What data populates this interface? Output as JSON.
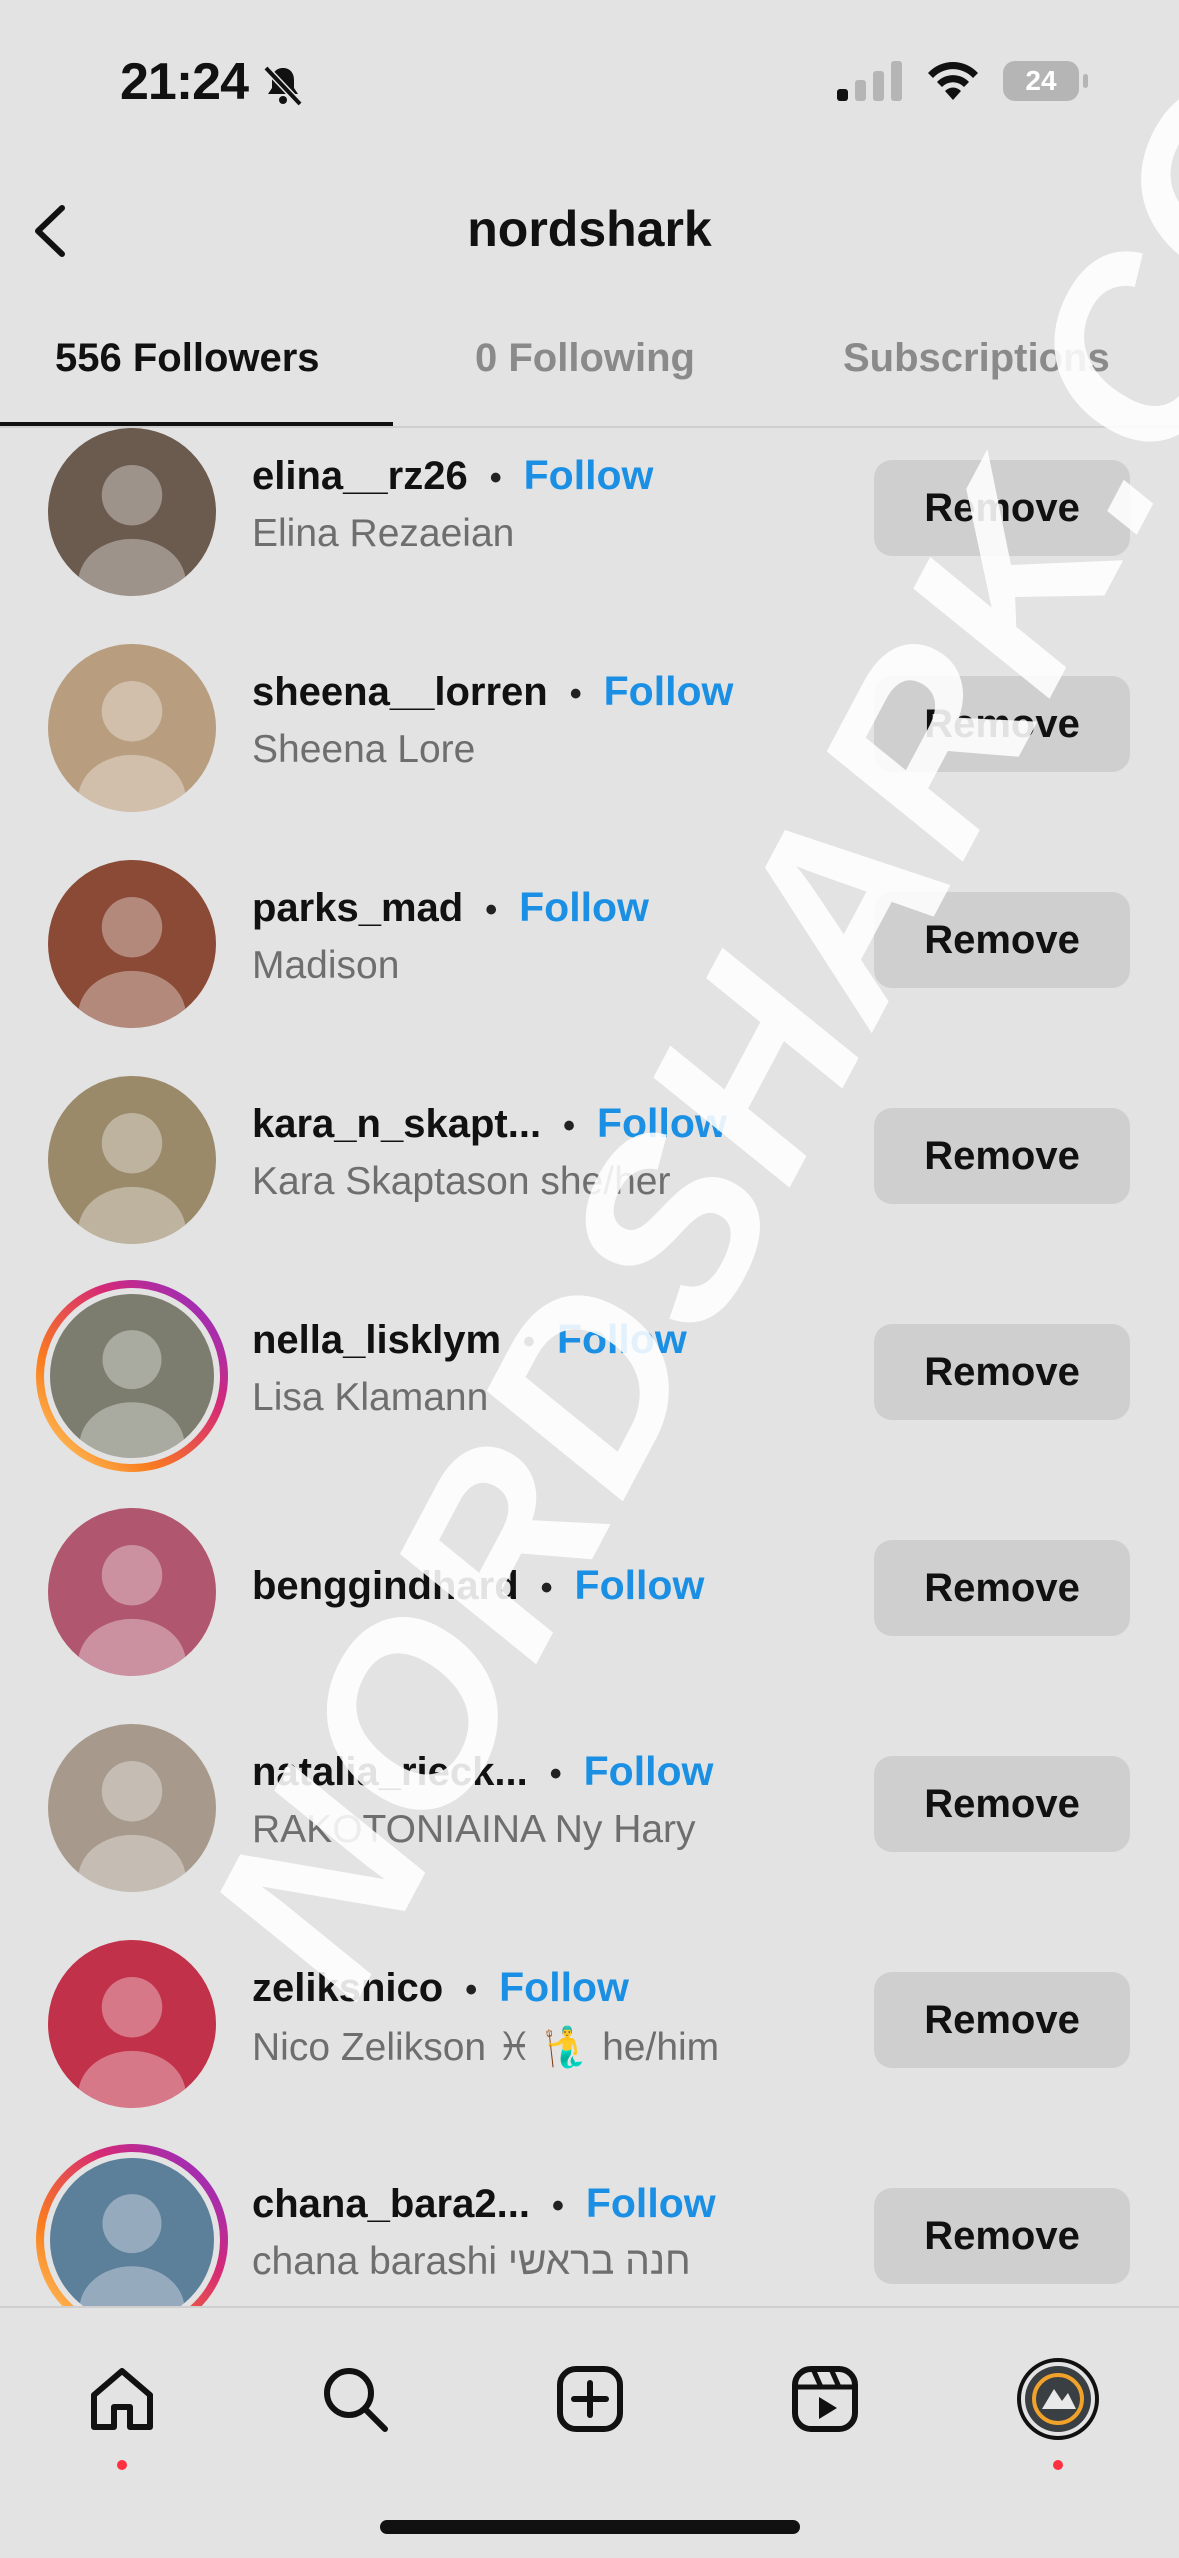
{
  "status_bar": {
    "time": "21:24",
    "battery": "24"
  },
  "header": {
    "title": "nordshark"
  },
  "tabs": [
    {
      "label": "556 Followers",
      "active": true
    },
    {
      "label": "0 Following",
      "active": false
    },
    {
      "label": "Subscriptions",
      "active": false
    }
  ],
  "followers": [
    {
      "username": "elina__rz26",
      "fullname": "Elina Rezaeian",
      "follow_label": "Follow",
      "remove_label": "Remove",
      "has_story": false,
      "avatar_color": "#6b5a4e"
    },
    {
      "username": "sheena__lorren",
      "fullname": "Sheena Lore",
      "follow_label": "Follow",
      "remove_label": "Remove",
      "has_story": false,
      "avatar_color": "#b89d7f"
    },
    {
      "username": "parks_mad",
      "fullname": "Madison",
      "follow_label": "Follow",
      "remove_label": "Remove",
      "has_story": false,
      "avatar_color": "#8a4a36"
    },
    {
      "username": "kara_n_skapt...",
      "fullname": "Kara Skaptason she/her",
      "follow_label": "Follow",
      "remove_label": "Remove",
      "has_story": false,
      "avatar_color": "#9a8a6a"
    },
    {
      "username": "nella_lisklym",
      "fullname": "Lisa Klamann",
      "follow_label": "Follow",
      "remove_label": "Remove",
      "has_story": true,
      "avatar_color": "#7c7d6e"
    },
    {
      "username": "benggindhard",
      "fullname": "",
      "follow_label": "Follow",
      "remove_label": "Remove",
      "has_story": false,
      "avatar_color": "#b0566e"
    },
    {
      "username": "natalia_rieck...",
      "fullname": "RAKOTONIAINA Ny Hary",
      "follow_label": "Follow",
      "remove_label": "Remove",
      "has_story": false,
      "avatar_color": "#a79a8c"
    },
    {
      "username": "zeliksnico",
      "fullname": "Nico Zelikson ♓ 🧜‍♂️ he/him",
      "follow_label": "Follow",
      "remove_label": "Remove",
      "has_story": false,
      "avatar_color": "#c2314a"
    },
    {
      "username": "chana_bara2...",
      "fullname": "chana barashi חנה בראשי",
      "follow_label": "Follow",
      "remove_label": "Remove",
      "has_story": true,
      "avatar_color": "#5c7f9a"
    }
  ],
  "bottom_nav": {
    "items": [
      {
        "icon": "home-icon",
        "has_dot": true
      },
      {
        "icon": "search-icon",
        "has_dot": false
      },
      {
        "icon": "create-icon",
        "has_dot": false
      },
      {
        "icon": "reels-icon",
        "has_dot": false
      },
      {
        "icon": "profile-avatar",
        "has_dot": true
      }
    ]
  },
  "watermark": "NORDSHARK.COM",
  "colors": {
    "follow": "#1a8fe3",
    "notification_dot": "#ff3040",
    "background": "#e3e3e3"
  }
}
